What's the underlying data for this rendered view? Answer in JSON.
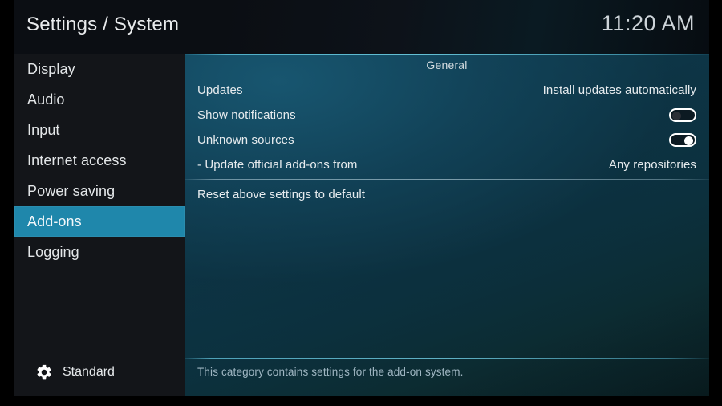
{
  "header": {
    "title": "Settings / System",
    "clock": "11:20 AM"
  },
  "sidebar": {
    "items": [
      {
        "label": "Display",
        "selected": false
      },
      {
        "label": "Audio",
        "selected": false
      },
      {
        "label": "Input",
        "selected": false
      },
      {
        "label": "Internet access",
        "selected": false
      },
      {
        "label": "Power saving",
        "selected": false
      },
      {
        "label": "Add-ons",
        "selected": true
      },
      {
        "label": "Logging",
        "selected": false
      }
    ],
    "footer": {
      "icon": "gear-icon",
      "level_label": "Standard"
    }
  },
  "content": {
    "group_header": "General",
    "rows": [
      {
        "name": "updates",
        "label": "Updates",
        "value": "Install updates automatically",
        "control": "text",
        "separator_below": false
      },
      {
        "name": "show-notifications",
        "label": "Show notifications",
        "value": "",
        "control": "toggle",
        "toggle_state": "off",
        "separator_below": false
      },
      {
        "name": "unknown-sources",
        "label": "Unknown sources",
        "value": "",
        "control": "toggle",
        "toggle_state": "on",
        "separator_below": false
      },
      {
        "name": "update-official-addons-from",
        "label": "- Update official add-ons from",
        "value": "Any repositories",
        "control": "text",
        "separator_below": true
      },
      {
        "name": "reset-above-settings-to-default",
        "label": "Reset above settings to default",
        "value": "",
        "control": "none",
        "separator_below": false
      }
    ],
    "help_text": "This category contains settings for the add-on system."
  },
  "colors": {
    "accent": "#1f87ab",
    "rule": "#6ec8de",
    "sidebar_bg": "#131519",
    "header_bg": "#0b0e13",
    "text": "#e6ebee",
    "help_text": "#9fb6c2",
    "frame": "#000000"
  }
}
